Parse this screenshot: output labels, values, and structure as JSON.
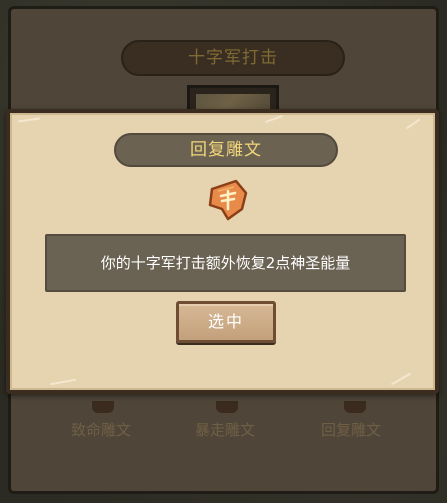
{
  "background": {
    "title": "十字军打击",
    "rune_labels": [
      "致命雕文",
      "暴走雕文",
      "回复雕文"
    ]
  },
  "modal": {
    "title": "回复雕文",
    "rune_icon": "rune-glyph-icon",
    "description": "你的十字军打击额外恢复2点神圣能量",
    "select_label": "选中"
  },
  "colors": {
    "modal_bg": "#e6d3b0",
    "title_text": "#f2d77a",
    "rune_orange": "#e88a4a",
    "button_bg": "#c9a683"
  }
}
